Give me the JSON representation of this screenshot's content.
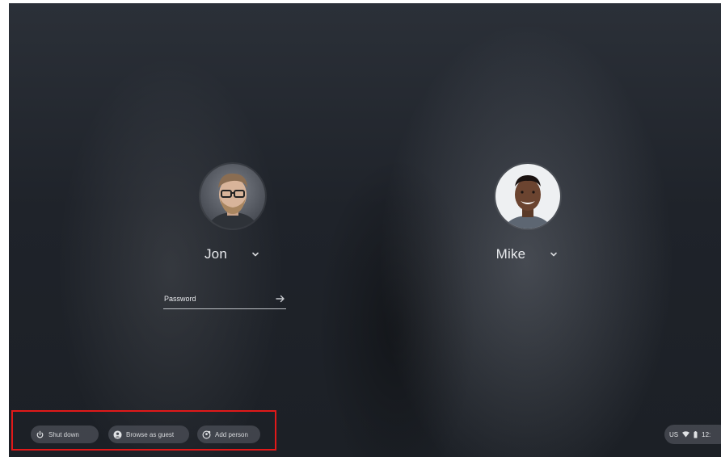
{
  "users": [
    {
      "name": "Jon",
      "avatar_icon": "user-photo-jon"
    },
    {
      "name": "Mike",
      "avatar_icon": "user-photo-mike"
    }
  ],
  "password": {
    "placeholder": "Password",
    "value": ""
  },
  "shelf": {
    "shutdown_label": "Shut down",
    "guest_label": "Browse as guest",
    "add_person_label": "Add person"
  },
  "status": {
    "keyboard": "US",
    "time": "12:"
  },
  "colors": {
    "highlight": "#e11919",
    "background": "#1f232a",
    "text": "#e8eaed"
  }
}
